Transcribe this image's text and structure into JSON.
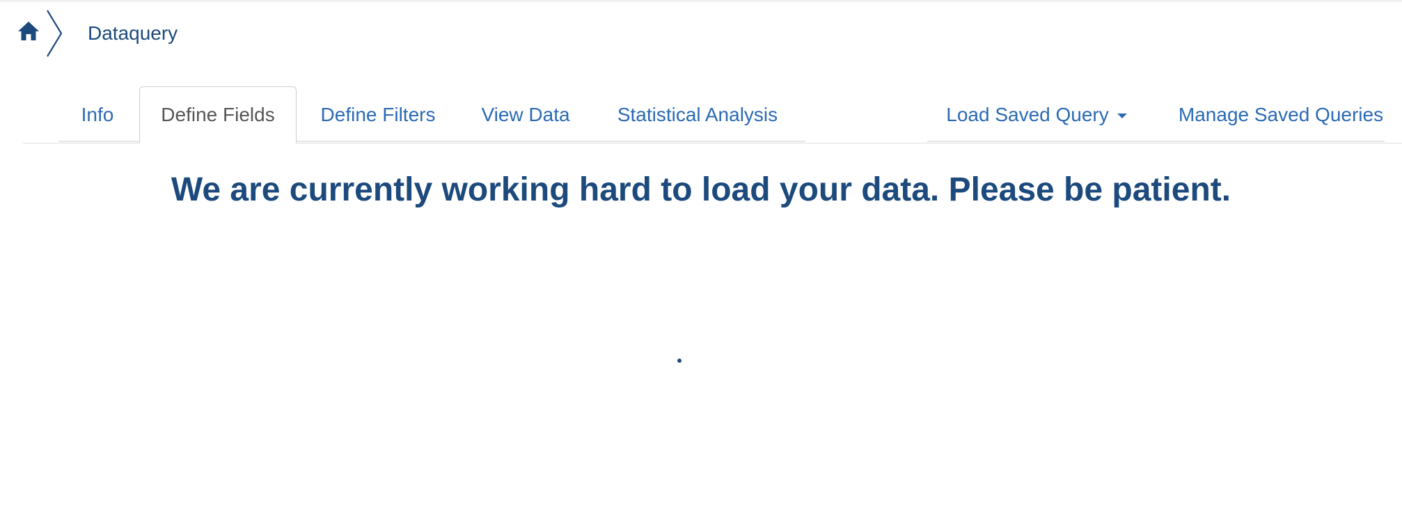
{
  "breadcrumb": {
    "home_icon": "home-icon",
    "separator_icon": "chevron-right-icon",
    "current": "Dataquery"
  },
  "tabs": {
    "left": [
      {
        "label": "Info",
        "active": false
      },
      {
        "label": "Define Fields",
        "active": true
      },
      {
        "label": "Define Filters",
        "active": false
      },
      {
        "label": "View Data",
        "active": false
      },
      {
        "label": "Statistical Analysis",
        "active": false
      }
    ],
    "right": [
      {
        "label": "Load Saved Query",
        "has_dropdown": true
      },
      {
        "label": "Manage Saved Queries",
        "has_dropdown": false
      }
    ]
  },
  "main": {
    "loading_message": "We are currently working hard to load your data. Please be patient.",
    "spinner_icon": "loading-spinner-icon"
  },
  "colors": {
    "link": "#2a6ab4",
    "heading": "#1c4a7d",
    "active_tab_text": "#555555",
    "border": "#dddddd"
  }
}
